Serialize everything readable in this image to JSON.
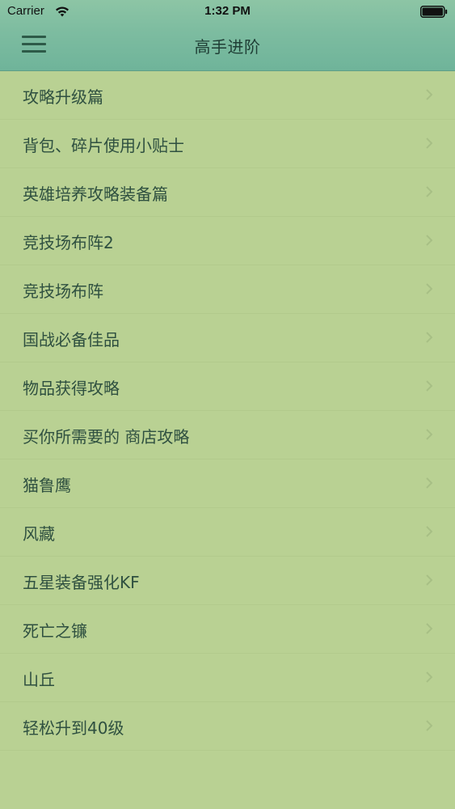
{
  "status_bar": {
    "carrier": "Carrier",
    "time": "1:32 PM",
    "icons": [
      "wifi-icon",
      "battery-icon"
    ]
  },
  "nav": {
    "title": "高手进阶",
    "menu_icon": "hamburger-menu-icon"
  },
  "colors": {
    "background": "#b9d193",
    "nav_bar": "#7dbca0",
    "text": "#2f5040",
    "chevron": "#a7bf85"
  },
  "list": {
    "items": [
      {
        "label": "攻略升级篇"
      },
      {
        "label": "背包、碎片使用小贴士"
      },
      {
        "label": "英雄培养攻略装备篇"
      },
      {
        "label": "竞技场布阵2"
      },
      {
        "label": "竞技场布阵"
      },
      {
        "label": "国战必备佳品"
      },
      {
        "label": "物品获得攻略"
      },
      {
        "label": "买你所需要的 商店攻略"
      },
      {
        "label": "猫鲁鹰"
      },
      {
        "label": "风藏"
      },
      {
        "label": "五星装备强化KF"
      },
      {
        "label": "死亡之镰"
      },
      {
        "label": "山丘"
      },
      {
        "label": "轻松升到40级"
      }
    ]
  }
}
